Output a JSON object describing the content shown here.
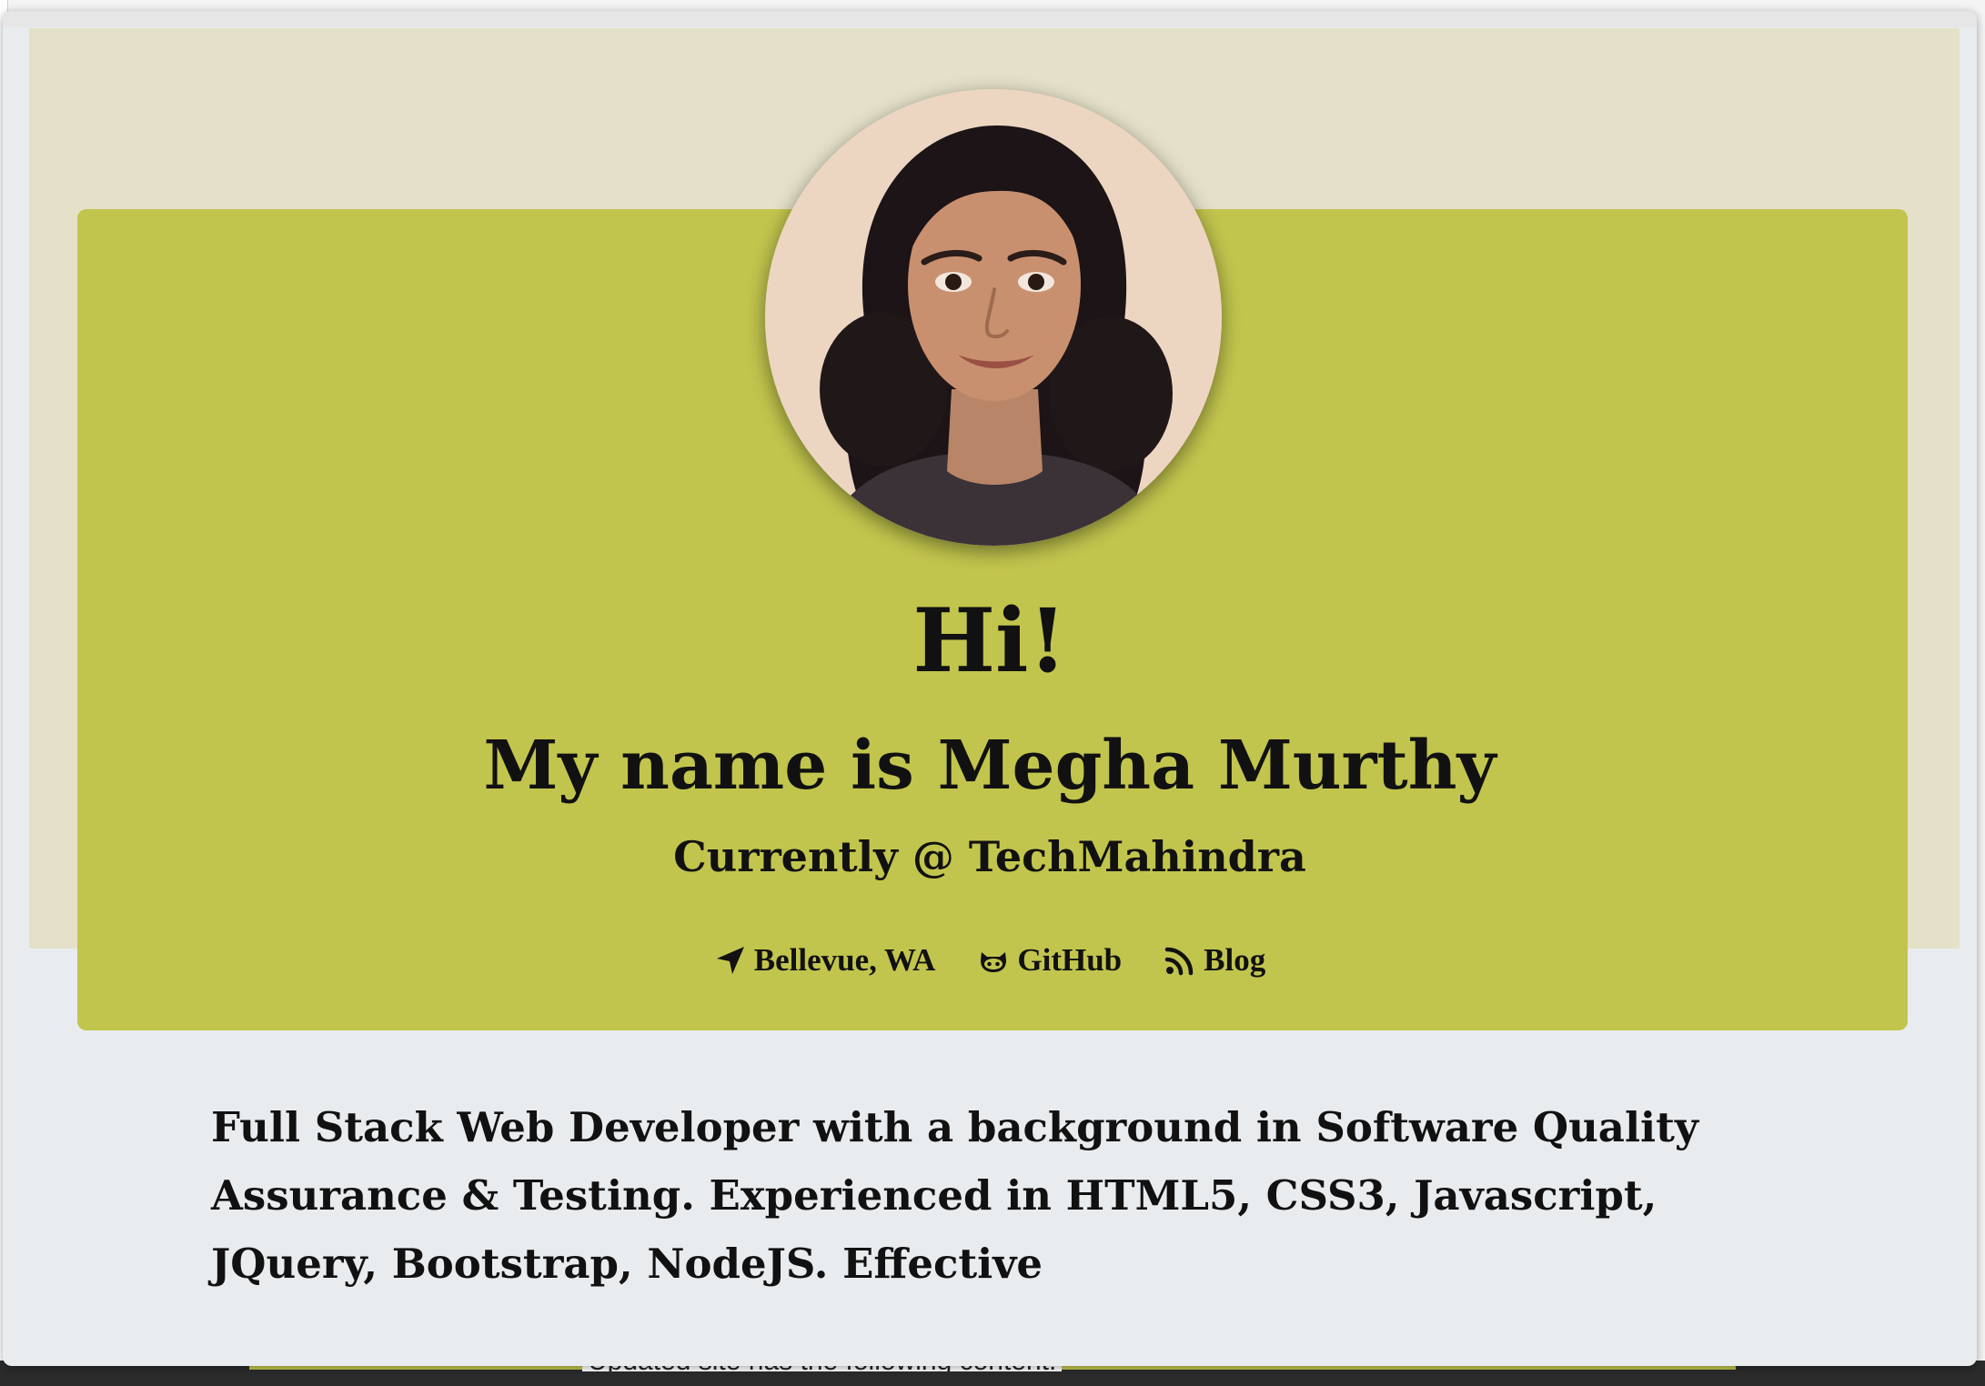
{
  "hero": {
    "greeting": "Hi!",
    "name": "My name is Megha Murthy",
    "employer": "Currently @ TechMahindra"
  },
  "links": [
    {
      "label": "Bellevue, WA",
      "icon": "location-arrow-icon"
    },
    {
      "label": "GitHub",
      "icon": "github-icon"
    },
    {
      "label": "Blog",
      "icon": "rss-icon"
    }
  ],
  "summary": "Full Stack Web Developer with a background in Software Quality Assurance & Testing. Experienced in HTML5, CSS3, Javascript, JQuery, Bootstrap, NodeJS. Effective",
  "background_page": {
    "note": "Updated site has the following content."
  },
  "colors": {
    "hero_band": "#e5e1c9",
    "hero_card": "#c2c54d",
    "modal_bg": "#e9ecee",
    "text": "#111111"
  }
}
